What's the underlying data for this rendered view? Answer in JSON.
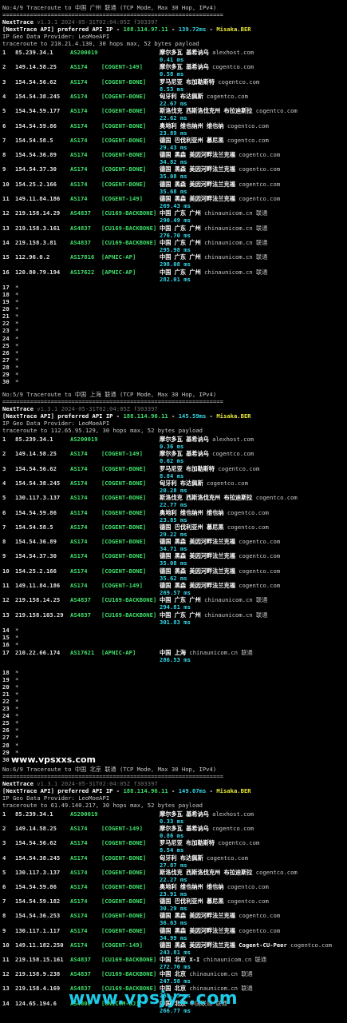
{
  "sections": [
    {
      "title": "No:4/9 Traceroute to 中国 广州 联通 (TCP Mode, Max 30 Hop, IPv4)",
      "sep": "================================================================",
      "app": "NextTrace",
      "version": " v1.3.1 2024-05-31T02:04:05Z f303397",
      "api_prefix": "[NextTrace API] preferred API IP - ",
      "api_ip": "188.114.97.11",
      "api_dash": " - ",
      "api_ms": "139.72ms",
      "api_dash2": " - ",
      "api_pop": "Misaka.BER",
      "provider": "IP Geo Data Provider: LeoMoeAPI",
      "traceroute": "traceroute to 210.21.4.130, 30 hops max, 52 bytes payload",
      "hops": [
        {
          "n": "1",
          "ip": "85.239.34.1",
          "as": "AS200019",
          "tag": "",
          "loc": "摩尔多瓦 基希讷乌",
          "host": "alexhost.com",
          "ms": "0.41 ms"
        },
        {
          "n": "2",
          "ip": "149.14.58.25",
          "as": "AS174",
          "tag": "[COGENT-149]",
          "loc": "摩尔多瓦 基希讷乌",
          "host": "cogentco.com",
          "ms": "0.58 ms"
        },
        {
          "n": "3",
          "ip": "154.54.56.62",
          "as": "AS174",
          "tag": "[COGENT-BONE]",
          "loc": "罗马尼亚 布加勒斯特",
          "host": "cogentco.com",
          "ms": "8.53 ms"
        },
        {
          "n": "4",
          "ip": "154.54.38.245",
          "as": "AS174",
          "tag": "[COGENT-BONE]",
          "loc": "匈牙利 布达佩斯",
          "host": "cogentco.com",
          "ms": "22.67 ms"
        },
        {
          "n": "5",
          "ip": "154.54.59.177",
          "as": "AS174",
          "tag": "[COGENT-BONE]",
          "loc": "斯洛伐克 西斯洛伐克州 布拉迪斯拉",
          "host": "cogentco.com",
          "ms": "22.62 ms"
        },
        {
          "n": "6",
          "ip": "154.54.59.86",
          "as": "AS174",
          "tag": "[COGENT-BONE]",
          "loc": "奥地利 维也纳州 维也纳",
          "host": "cogentco.com",
          "ms": "23.89 ms"
        },
        {
          "n": "7",
          "ip": "154.54.58.5",
          "as": "AS174",
          "tag": "[COGENT-BONE]",
          "loc": "德国 巴伐利亚州 慕尼黑",
          "host": "cogentco.com",
          "ms": "29.43 ms"
        },
        {
          "n": "8",
          "ip": "154.54.36.89",
          "as": "AS174",
          "tag": "[COGENT-BONE]",
          "loc": "德国 黑森 美因河畔法兰克福",
          "host": "cogentco.com",
          "ms": "34.82 ms"
        },
        {
          "n": "9",
          "ip": "154.54.37.30",
          "as": "AS174",
          "tag": "[COGENT-BONE]",
          "loc": "德国 黑森 美因河畔法兰克福",
          "host": "cogentco.com",
          "ms": "35.08 ms"
        },
        {
          "n": "10",
          "ip": "154.25.2.166",
          "as": "AS174",
          "tag": "[COGENT-BONE]",
          "loc": "德国 黑森 美因河畔法兰克福",
          "host": "cogentco.com",
          "ms": "35.68 ms"
        },
        {
          "n": "11",
          "ip": "149.11.84.186",
          "as": "AS174",
          "tag": "[COGENT-149]",
          "loc": "德国 黑森 美因河畔法兰克福",
          "host": "cogentco.com",
          "ms": "269.43 ms"
        },
        {
          "n": "12",
          "ip": "219.158.14.29",
          "as": "AS4837",
          "tag": "[CU169-BACKBONE]",
          "loc": "中国 广东 广州",
          "host": "chinaunicom.cn  联通",
          "ms": "290.49 ms"
        },
        {
          "n": "13",
          "ip": "219.158.3.161",
          "as": "AS4837",
          "tag": "[CU169-BACKBONE]",
          "loc": "中国 广东 广州",
          "host": "chinaunicom.cn  联通",
          "ms": "276.70 ms"
        },
        {
          "n": "14",
          "ip": "219.158.3.81",
          "as": "AS4837",
          "tag": "[CU169-BACKBONE]",
          "loc": "中国 广东 广州",
          "host": "chinaunicom.cn  联通",
          "ms": "295.98 ms"
        },
        {
          "n": "15",
          "ip": "112.96.0.2",
          "as": "AS17816",
          "tag": "[APNIC-AP]",
          "loc": "中国 广东 广州",
          "host": "chinaunicom.cn  联通",
          "ms": "298.08 ms"
        },
        {
          "n": "16",
          "ip": "120.80.79.194",
          "as": "AS17622",
          "tag": "[APNIC-AP]",
          "loc": "中国 广东 广州",
          "host": "chinaunicom.cn  联通",
          "ms": "282.01 ms"
        }
      ],
      "stars": [
        "17",
        "18",
        "19",
        "20",
        "21",
        "22",
        "23",
        "24",
        "25",
        "26",
        "27",
        "28",
        "29",
        "30"
      ]
    },
    {
      "title": "No:5/9 Traceroute to 中国 上海 联通 (TCP Mode, Max 30 Hop, IPv4)",
      "sep": "================================================================",
      "app": "NextTrace",
      "version": " v1.3.1 2024-05-31T02:04:05Z f303397",
      "api_prefix": "[NextTrace API] preferred API IP - ",
      "api_ip": "188.114.96.11",
      "api_dash": " - ",
      "api_ms": "145.59ms",
      "api_dash2": " - ",
      "api_pop": "Misaka.BER",
      "provider": "IP Geo Data Provider: LeoMoeAPI",
      "traceroute": "traceroute to 112.65.95.129, 30 hops max, 52 bytes payload",
      "hops": [
        {
          "n": "1",
          "ip": "85.239.34.1",
          "as": "AS200019",
          "tag": "",
          "loc": "摩尔多瓦 基希讷乌",
          "host": "alexhost.com",
          "ms": "0.36 ms"
        },
        {
          "n": "2",
          "ip": "149.14.58.25",
          "as": "AS174",
          "tag": "[COGENT-149]",
          "loc": "摩尔多瓦 基希讷乌",
          "host": "cogentco.com",
          "ms": "0.62 ms"
        },
        {
          "n": "3",
          "ip": "154.54.56.62",
          "as": "AS174",
          "tag": "[COGENT-BONE]",
          "loc": "罗马尼亚 布加勒斯特",
          "host": "cogentco.com",
          "ms": "8.84 ms"
        },
        {
          "n": "4",
          "ip": "154.54.38.245",
          "as": "AS174",
          "tag": "[COGENT-BONE]",
          "loc": "匈牙利 布达佩斯",
          "host": "cogentco.com",
          "ms": "20.28 ms"
        },
        {
          "n": "5",
          "ip": "130.117.3.137",
          "as": "AS174",
          "tag": "[COGENT-BONE]",
          "loc": "斯洛伐克 西斯洛伐克州 布拉迪斯拉",
          "host": "cogentco.com",
          "ms": "22.77 ms"
        },
        {
          "n": "6",
          "ip": "154.54.59.86",
          "as": "AS174",
          "tag": "[COGENT-BONE]",
          "loc": "奥地利 维也纳州 维也纳",
          "host": "cogentco.com",
          "ms": "23.85 ms"
        },
        {
          "n": "7",
          "ip": "154.54.58.5",
          "as": "AS174",
          "tag": "[COGENT-BONE]",
          "loc": "德国 巴伐利亚州 慕尼黑",
          "host": "cogentco.com",
          "ms": "29.22 ms"
        },
        {
          "n": "8",
          "ip": "154.54.36.89",
          "as": "AS174",
          "tag": "[COGENT-BONE]",
          "loc": "德国 黑森 美因河畔法兰克福",
          "host": "cogentco.com",
          "ms": "34.71 ms"
        },
        {
          "n": "9",
          "ip": "154.54.37.30",
          "as": "AS174",
          "tag": "[COGENT-BONE]",
          "loc": "德国 黑森 美因河畔法兰克福",
          "host": "cogentco.com",
          "ms": "35.08 ms"
        },
        {
          "n": "10",
          "ip": "154.25.2.166",
          "as": "AS174",
          "tag": "[COGENT-BONE]",
          "loc": "德国 黑森 美因河畔法兰克福",
          "host": "cogentco.com",
          "ms": "35.62 ms"
        },
        {
          "n": "11",
          "ip": "149.11.84.186",
          "as": "AS174",
          "tag": "[COGENT-149]",
          "loc": "德国 黑森 美因河畔法兰克福",
          "host": "cogentco.com",
          "ms": "269.57 ms"
        },
        {
          "n": "12",
          "ip": "219.158.14.25",
          "as": "AS4837",
          "tag": "[CU169-BACKBONE]",
          "loc": "中国 广东 广州",
          "host": "chinaunicom.cn  联通",
          "ms": "294.81 ms"
        },
        {
          "n": "13",
          "ip": "219.158.103.29",
          "as": "AS4837",
          "tag": "[CU169-BACKBONE]",
          "loc": "中国 广东 广州",
          "host": "chinaunicom.cn  联通",
          "ms": "301.83 ms"
        }
      ],
      "stars_a": [
        "14",
        "15",
        "16"
      ],
      "hop17": {
        "n": "17",
        "ip": "210.22.66.174",
        "as": "AS17621",
        "tag": "[APNIC-AP]",
        "loc": "中国 上海",
        "host": "chinaunicom.cn  联通",
        "ms": "286.53 ms"
      },
      "stars_b": [
        "18",
        "19",
        "20",
        "21",
        "22",
        "23",
        "24",
        "25",
        "26",
        "27",
        "28",
        "29",
        "30"
      ]
    },
    {
      "title": "No:6/9 Traceroute to 中国 北京 联通 (TCP Mode, Max 30 Hop, IPv4)",
      "sep": "================================================================",
      "app": "NextTrace",
      "version": " v1.3.1 2024-05-31T02:04:05Z f303397",
      "api_prefix": "[NextTrace API] preferred API IP - ",
      "api_ip": "188.114.96.11",
      "api_dash": " - ",
      "api_ms": "149.07ms",
      "api_dash2": " - ",
      "api_pop": "Misaka.BER",
      "provider": "IP Geo Data Provider: LeoMoeAPI",
      "traceroute": "traceroute to 61.49.140.217, 30 hops max, 52 bytes payload",
      "hops": [
        {
          "n": "1",
          "ip": "85.239.34.1",
          "as": "AS200019",
          "tag": "",
          "loc": "摩尔多瓦 基希讷乌",
          "host": "alexhost.com",
          "ms": "0.33 ms"
        },
        {
          "n": "2",
          "ip": "149.14.58.25",
          "as": "AS174",
          "tag": "[COGENT-149]",
          "loc": "摩尔多瓦 基希讷乌",
          "host": "cogentco.com",
          "ms": "0.86 ms"
        },
        {
          "n": "3",
          "ip": "154.54.56.62",
          "as": "AS174",
          "tag": "[COGENT-BONE]",
          "loc": "罗马尼亚 布加勒斯特",
          "host": "cogentco.com",
          "ms": "8.54 ms"
        },
        {
          "n": "4",
          "ip": "154.54.38.245",
          "as": "AS174",
          "tag": "[COGENT-BONE]",
          "loc": "匈牙利 布达佩斯",
          "host": "cogentco.com",
          "ms": "27.87 ms"
        },
        {
          "n": "5",
          "ip": "130.117.3.137",
          "as": "AS174",
          "tag": "[COGENT-BONE]",
          "loc": "斯洛伐克 西斯洛伐克州 布拉迪斯拉",
          "host": "cogentco.com",
          "ms": "22.27 ms"
        },
        {
          "n": "6",
          "ip": "154.54.59.86",
          "as": "AS174",
          "tag": "[COGENT-BONE]",
          "loc": "奥地利 维也纳州 维也纳",
          "host": "cogentco.com",
          "ms": "23.91 ms"
        },
        {
          "n": "7",
          "ip": "154.54.59.182",
          "as": "AS174",
          "tag": "[COGENT-BONE]",
          "loc": "德国 巴伐利亚州 慕尼黑",
          "host": "cogentco.com",
          "ms": "30.29 ms"
        },
        {
          "n": "8",
          "ip": "154.54.36.253",
          "as": "AS174",
          "tag": "[COGENT-BONE]",
          "loc": "德国 黑森 美因河畔法兰克福",
          "host": "cogentco.com",
          "ms": "36.63 ms"
        },
        {
          "n": "9",
          "ip": "130.117.1.117",
          "as": "AS174",
          "tag": "[COGENT-BONE]",
          "loc": "德国 黑森 美因河畔法兰克福",
          "host": "cogentco.com",
          "ms": "34.99 ms"
        },
        {
          "n": "10",
          "ip": "149.11.182.250",
          "as": "AS174",
          "tag": "[COGENT-149]",
          "loc": "德国 黑森 美因河畔法兰克福 Cogent-CU-Peer",
          "host": "cogentco.com",
          "ms": "243.81 ms"
        },
        {
          "n": "11",
          "ip": "219.158.15.161",
          "as": "AS4837",
          "tag": "[CU169-BACKBONE]",
          "loc": "中国 北京  X-I",
          "host": "chinaunicom.cn  联通",
          "ms": "272.70 ms"
        },
        {
          "n": "12",
          "ip": "219.158.9.238",
          "as": "AS4837",
          "tag": "[CU169-BACKBONE]",
          "loc": "中国 北京",
          "host": "chinaunicom.cn  联通",
          "ms": "247.58 ms"
        },
        {
          "n": "13",
          "ip": "219.158.4.169",
          "as": "AS4837",
          "tag": "[CU169-BACKBONE]",
          "loc": "中国 北京",
          "host": "chinaunicom.cn  联通",
          "ms": "261.55 ms"
        },
        {
          "n": "14",
          "ip": "124.65.194.6",
          "as": "AS4808",
          "tag": "[UNICOM-BJ]",
          "loc": "中国 北京",
          "host": "中国联通  联通",
          "ms": "266.77 ms"
        }
      ]
    }
  ],
  "watermarks": {
    "top": "www.vpsxxs.com",
    "bottom": "www.vpsjyz.com"
  },
  "colors": {
    "bg": "#000000",
    "cyan": "#33d6e8",
    "green": "#3fe06a",
    "yellow": "#e8e83a",
    "white": "#ffffff"
  }
}
